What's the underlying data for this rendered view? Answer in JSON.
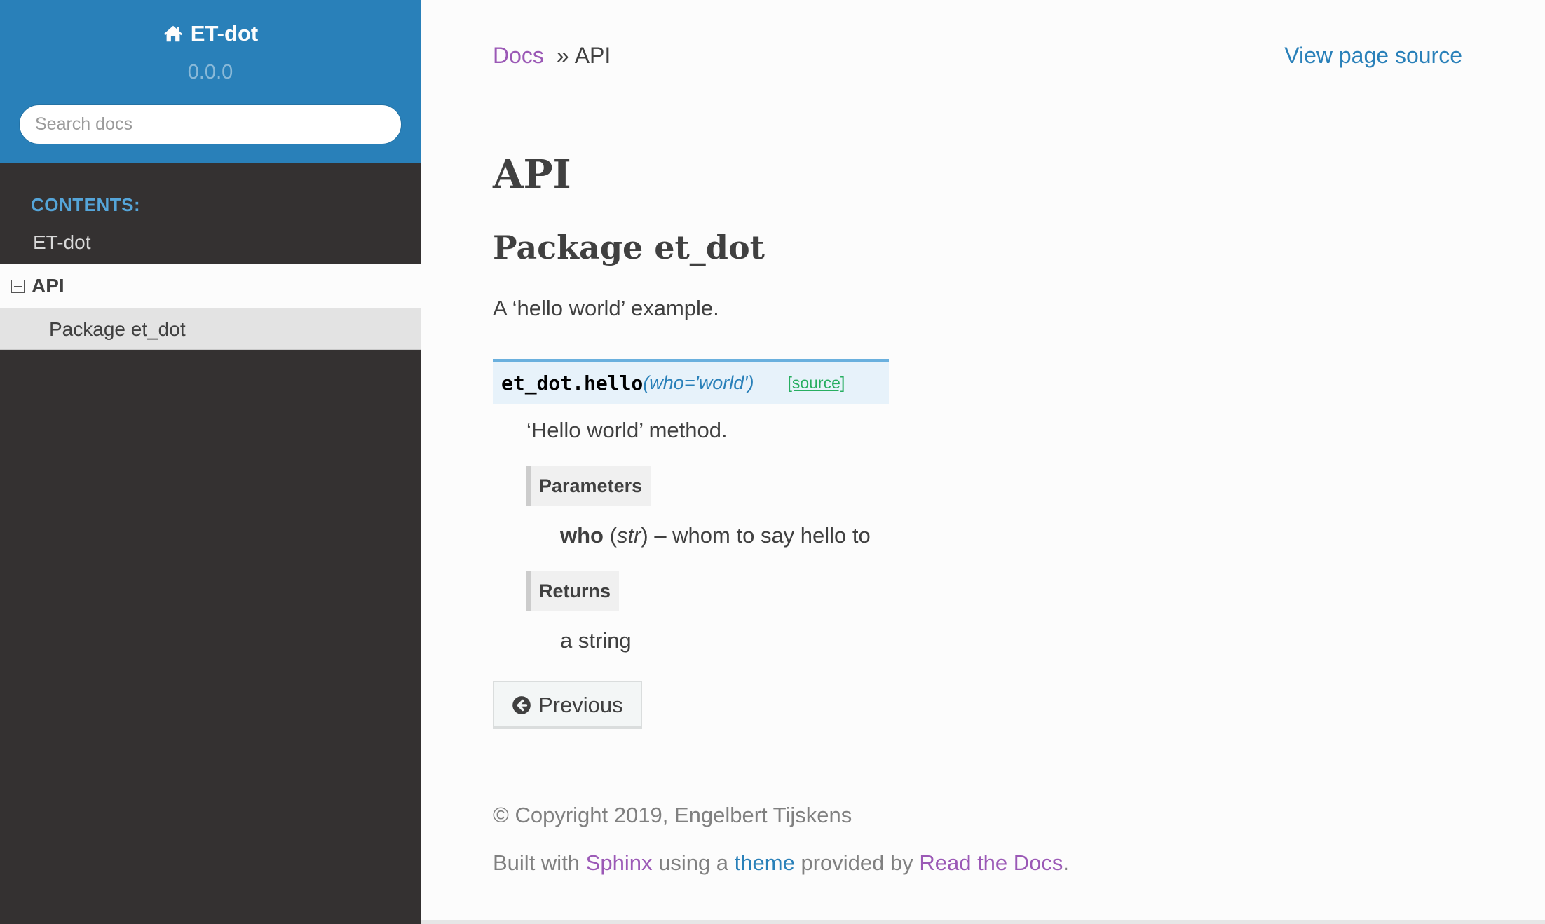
{
  "sidebar": {
    "project_name": "ET-dot",
    "version": "0.0.0",
    "search_placeholder": "Search docs",
    "caption": "CONTENTS:",
    "items": [
      {
        "label": "ET-dot"
      },
      {
        "label": "API"
      },
      {
        "label": "Package et_dot"
      }
    ]
  },
  "breadcrumbs": {
    "home_label": "Docs",
    "separator": "»",
    "current": "API",
    "view_source": "View page source"
  },
  "page": {
    "title": "API",
    "section_title": "Package et_dot",
    "intro": "A ‘hello world’ example."
  },
  "function": {
    "name": "et_dot.hello",
    "open_paren": "(",
    "params": "who='world'",
    "close_paren": ")",
    "source_label": "[source]",
    "description": "‘Hello world’ method.",
    "parameters_label": "Parameters",
    "param_name": "who",
    "param_type_open": " (",
    "param_type": "str",
    "param_type_close": ")",
    "param_desc": " – whom to say hello to",
    "returns_label": "Returns",
    "returns_desc": "a string"
  },
  "nav_buttons": {
    "previous": "Previous"
  },
  "footer": {
    "copyright": "© Copyright 2019, Engelbert Tijskens",
    "built_prefix": "Built with ",
    "sphinx": "Sphinx",
    "using": " using a ",
    "theme": "theme",
    "provided": " provided by ",
    "rtd": "Read the Docs",
    "period": "."
  },
  "colors": {
    "sidebar_header": "#2980B9",
    "sidebar_bg": "#343131",
    "link_visited": "#9B59B6",
    "link": "#2980B9",
    "source_link": "#27AE60"
  }
}
